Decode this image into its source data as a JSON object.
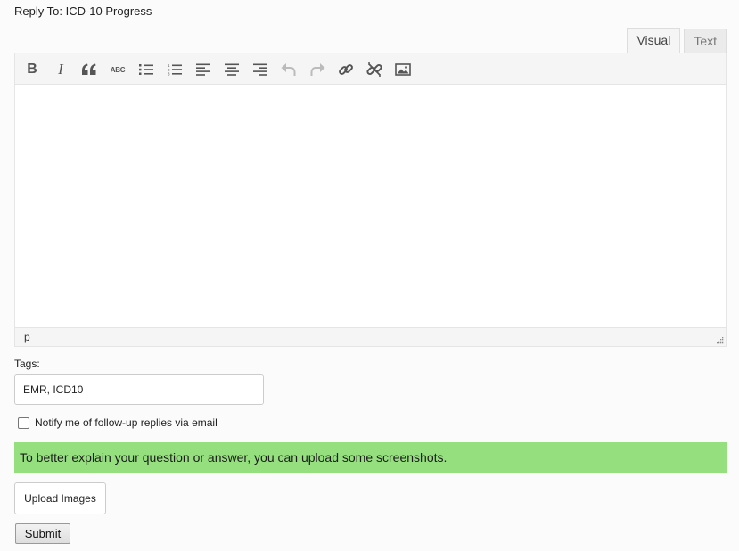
{
  "reply": {
    "prefix": "Reply To:",
    "topic": "ICD-10 Progress"
  },
  "editor": {
    "tabs": [
      {
        "label": "Visual",
        "active": true
      },
      {
        "label": "Text",
        "active": false
      }
    ],
    "toolbar": [
      {
        "name": "bold",
        "label": "B"
      },
      {
        "name": "italic",
        "label": "I"
      },
      {
        "name": "blockquote",
        "icon": "quote-icon"
      },
      {
        "name": "strikethrough",
        "label": "ABC"
      },
      {
        "name": "bullet-list",
        "icon": "bullet-list-icon"
      },
      {
        "name": "numbered-list",
        "icon": "numbered-list-icon"
      },
      {
        "name": "align-left",
        "icon": "align-left-icon"
      },
      {
        "name": "align-center",
        "icon": "align-center-icon"
      },
      {
        "name": "align-right",
        "icon": "align-right-icon"
      },
      {
        "name": "undo",
        "icon": "undo-icon",
        "disabled": true
      },
      {
        "name": "redo",
        "icon": "redo-icon",
        "disabled": true
      },
      {
        "name": "insert-link",
        "icon": "link-icon"
      },
      {
        "name": "remove-link",
        "icon": "unlink-icon"
      },
      {
        "name": "insert-image",
        "icon": "image-icon"
      }
    ],
    "content": "",
    "status_path": "p"
  },
  "tags": {
    "label": "Tags:",
    "value": "EMR, ICD10"
  },
  "notify": {
    "label": "Notify me of follow-up replies via email",
    "checked": false
  },
  "upload": {
    "banner_text": "To better explain your question or answer, you can upload some screenshots.",
    "button_label": "Upload Images",
    "banner_color": "#96df7f"
  },
  "submit": {
    "label": "Submit"
  },
  "colors": {
    "icon": "#555555",
    "icon_disabled": "#bbbbbb"
  }
}
